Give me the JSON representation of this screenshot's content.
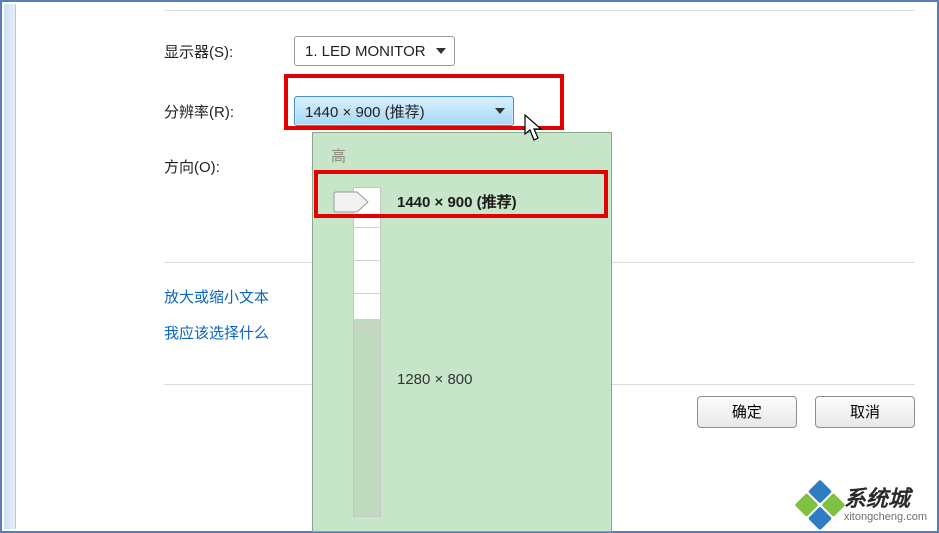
{
  "form": {
    "display_label": "显示器(S):",
    "display_value": "1. LED MONITOR",
    "resolution_label": "分辨率(R):",
    "resolution_value": "1440 × 900 (推荐)",
    "orientation_label": "方向(O):"
  },
  "panel": {
    "top_label": "高",
    "current": "1440 × 900 (推荐)",
    "mid": "1280 × 800"
  },
  "links": {
    "zoom_text": "放大或缩小文本",
    "which": "我应该选择什么"
  },
  "buttons": {
    "ok": "确定",
    "cancel": "取消"
  },
  "watermark": {
    "title": "系统城",
    "url": "xitongcheng.com",
    "colors": [
      "#2e7cc1",
      "#7fc143",
      "#2e7cc1",
      "#7fc143"
    ]
  }
}
